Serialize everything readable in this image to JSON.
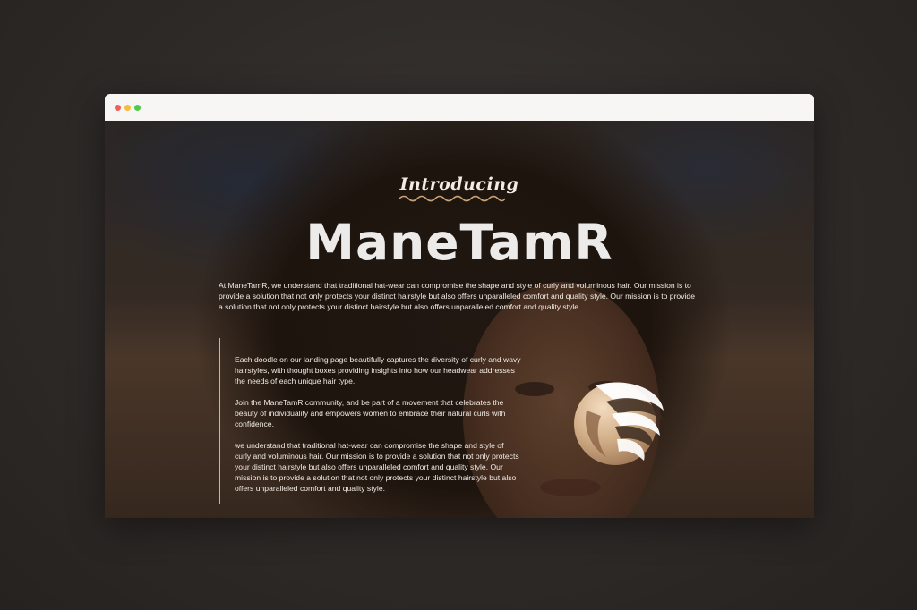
{
  "window": {
    "controls": [
      "close",
      "minimize",
      "maximize"
    ]
  },
  "hero": {
    "eyebrow": "Introducing",
    "title": "ManeTamR",
    "intro": "At ManeTamR, we understand that traditional hat-wear can compromise the shape and style of curly and voluminous hair. Our mission is to provide a solution that not only protects your distinct hairstyle but also offers unparalleled comfort and quality style. Our mission is to provide a solution that not only protects your distinct hairstyle but also offers unparalleled comfort and quality style."
  },
  "content": {
    "paragraphs": [
      "Each doodle on our landing page beautifully captures the diversity of curly and wavy hairstyles, with thought boxes providing insights into how our headwear addresses the needs of each unique hair type.",
      "Join the ManeTamR community, and be part of a movement that celebrates the beauty of individuality and empowers women to embrace their natural curls with confidence.",
      "we understand that traditional hat-wear can compromise the shape and style of curly and voluminous hair. Our mission is to provide a solution that not only protects your distinct hairstyle but also offers unparalleled comfort and quality style. Our mission is to provide a solution that not only protects your distinct hairstyle but also offers unparalleled comfort and quality style."
    ]
  },
  "logo": {
    "icon": "flowing-hair-logo-icon"
  },
  "colors": {
    "accent_gold": "#c9a27a",
    "text_light": "#f1ebe4",
    "title_light": "#ecebea"
  }
}
